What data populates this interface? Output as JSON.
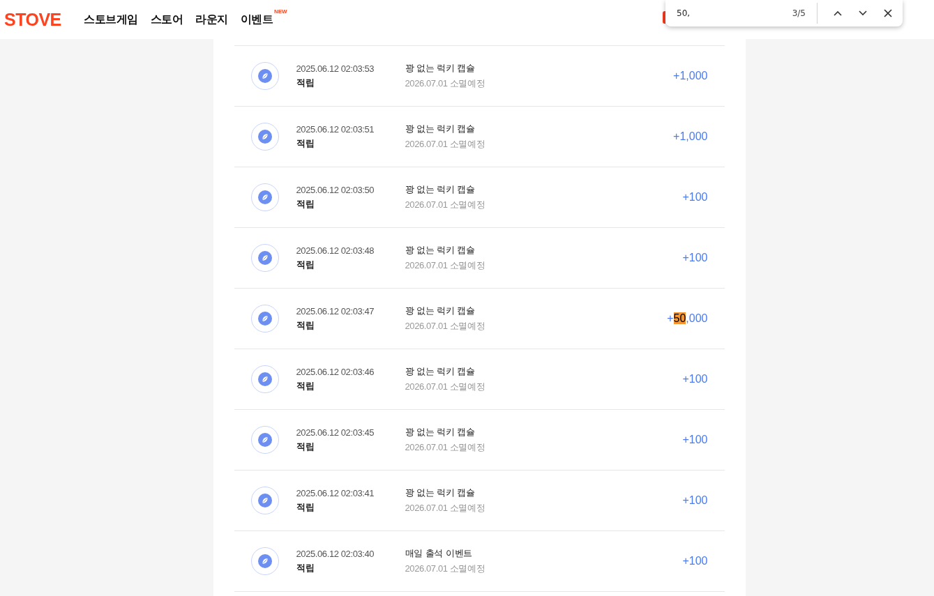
{
  "header": {
    "logo": "STOVE",
    "nav": [
      {
        "label": "스토브게임"
      },
      {
        "label": "스토어"
      },
      {
        "label": "라운지"
      },
      {
        "label": "이벤트",
        "badge": "NEW"
      }
    ]
  },
  "find_bar": {
    "query": "50,",
    "count": "3/5"
  },
  "history": [
    {
      "datetime": "2025.06.12 02:03:53",
      "type": "적립",
      "title": "꽝 없는 럭키 캡슐",
      "expiry": "2026.07.01 소멸예정",
      "amount": [
        {
          "text": "+1,000",
          "highlighted": false
        }
      ]
    },
    {
      "datetime": "2025.06.12 02:03:51",
      "type": "적립",
      "title": "꽝 없는 럭키 캡슐",
      "expiry": "2026.07.01 소멸예정",
      "amount": [
        {
          "text": "+1,000",
          "highlighted": false
        }
      ]
    },
    {
      "datetime": "2025.06.12 02:03:50",
      "type": "적립",
      "title": "꽝 없는 럭키 캡슐",
      "expiry": "2026.07.01 소멸예정",
      "amount": [
        {
          "text": "+100",
          "highlighted": false
        }
      ]
    },
    {
      "datetime": "2025.06.12 02:03:48",
      "type": "적립",
      "title": "꽝 없는 럭키 캡슐",
      "expiry": "2026.07.01 소멸예정",
      "amount": [
        {
          "text": "+100",
          "highlighted": false
        }
      ]
    },
    {
      "datetime": "2025.06.12 02:03:47",
      "type": "적립",
      "title": "꽝 없는 럭키 캡슐",
      "expiry": "2026.07.01 소멸예정",
      "amount": [
        {
          "text": "+",
          "highlighted": false
        },
        {
          "text": "50",
          "highlighted": true
        },
        {
          "text": ",000",
          "highlighted": false
        }
      ]
    },
    {
      "datetime": "2025.06.12 02:03:46",
      "type": "적립",
      "title": "꽝 없는 럭키 캡슐",
      "expiry": "2026.07.01 소멸예정",
      "amount": [
        {
          "text": "+100",
          "highlighted": false
        }
      ]
    },
    {
      "datetime": "2025.06.12 02:03:45",
      "type": "적립",
      "title": "꽝 없는 럭키 캡슐",
      "expiry": "2026.07.01 소멸예정",
      "amount": [
        {
          "text": "+100",
          "highlighted": false
        }
      ]
    },
    {
      "datetime": "2025.06.12 02:03:41",
      "type": "적립",
      "title": "꽝 없는 럭키 캡슐",
      "expiry": "2026.07.01 소멸예정",
      "amount": [
        {
          "text": "+100",
          "highlighted": false
        }
      ]
    },
    {
      "datetime": "2025.06.12 02:03:40",
      "type": "적립",
      "title": "매일 출석 이벤트",
      "expiry": "2026.07.01 소멸예정",
      "amount": [
        {
          "text": "+100",
          "highlighted": false
        }
      ]
    }
  ]
}
